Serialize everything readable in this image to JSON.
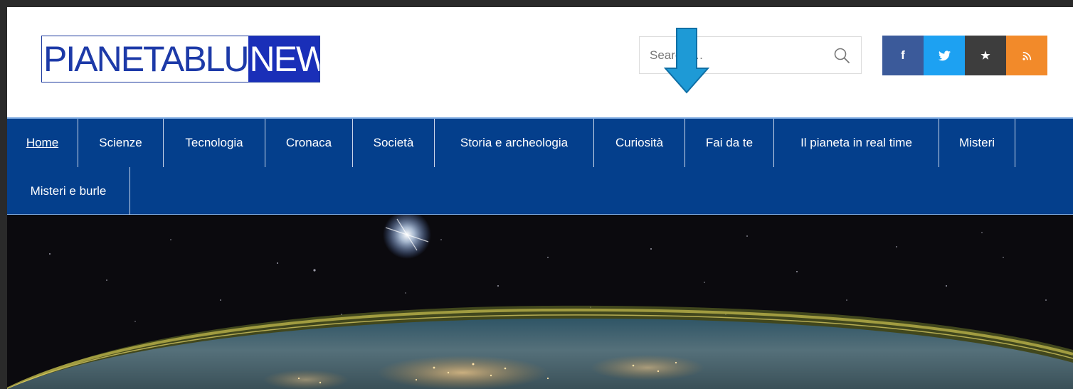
{
  "header": {
    "logo": {
      "part1": "PIANETABLU",
      "part2": "NEWS"
    },
    "search": {
      "placeholder": "Search …"
    },
    "social": [
      {
        "name": "facebook",
        "glyph": "f",
        "color": "#3b5a9a"
      },
      {
        "name": "twitter",
        "glyph": "🐦",
        "color": "#1da1f2"
      },
      {
        "name": "star",
        "glyph": "★",
        "color": "#3d3d3d"
      },
      {
        "name": "rss",
        "glyph": "ℂ",
        "color": "#f28a2a"
      }
    ]
  },
  "nav": {
    "items": [
      {
        "label": "Home",
        "active": true
      },
      {
        "label": "Scienze"
      },
      {
        "label": "Tecnologia"
      },
      {
        "label": "Cronaca"
      },
      {
        "label": "Società"
      },
      {
        "label": "Storia e archeologia"
      },
      {
        "label": "Curiosità"
      },
      {
        "label": "Fai da te"
      },
      {
        "label": "Il pianeta in real time"
      },
      {
        "label": "Misteri"
      },
      {
        "label": "Misteri e burle"
      }
    ]
  },
  "colors": {
    "nav_bg": "#043f8c",
    "logo_blue": "#1a2fb8",
    "annotation_arrow": "#1e9ad6"
  },
  "icons": {
    "search": "magnifier-icon",
    "arrow": "down-arrow-icon"
  }
}
